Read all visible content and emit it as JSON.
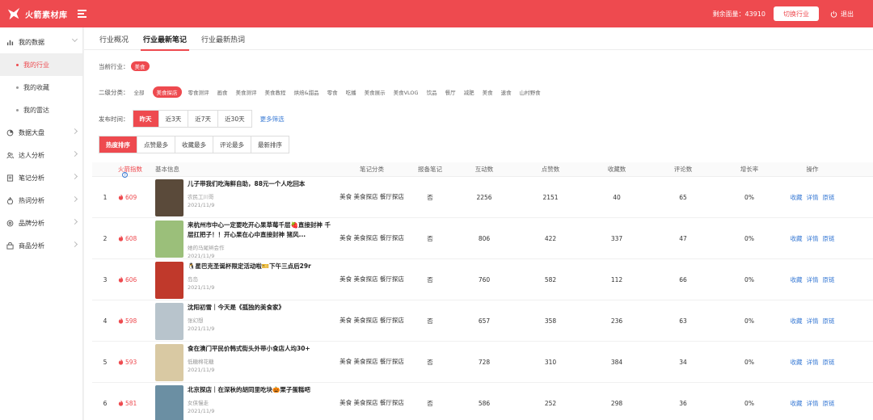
{
  "header": {
    "brand": "火箭素材库",
    "quota_text": "剩余面量：43910",
    "switch_label": "切换行业",
    "logout_label": "退出"
  },
  "sidebar": {
    "groups": [
      {
        "label": "我的数据",
        "icon": "bar-chart-icon",
        "expanded": true,
        "children": [
          "我的行业",
          "我的收藏",
          "我的雷达"
        ],
        "active_child": 0
      },
      {
        "label": "数据大盘",
        "icon": "pie-chart-icon"
      },
      {
        "label": "达人分析",
        "icon": "users-icon"
      },
      {
        "label": "笔记分析",
        "icon": "notes-icon"
      },
      {
        "label": "热词分析",
        "icon": "fire-icon"
      },
      {
        "label": "品牌分析",
        "icon": "brand-icon"
      },
      {
        "label": "商品分析",
        "icon": "goods-icon"
      }
    ]
  },
  "tabs": [
    "行业概况",
    "行业最新笔记",
    "行业最新热词"
  ],
  "active_tab": 1,
  "filters": {
    "industry_label": "当前行业：",
    "industry_value": "美食",
    "sub_label": "二级分类：",
    "sub_categories": [
      "全部",
      "美食探店",
      "零食测评",
      "画食",
      "美食测评",
      "美食教程",
      "烘焙&甜品",
      "零食",
      "吃播",
      "美食展示",
      "美食VLOG",
      "饮品",
      "餐厅",
      "减肥",
      "美食",
      "速食",
      "山村野食"
    ],
    "sub_active": 1,
    "time_label": "发布时间：",
    "time_options": [
      "昨天",
      "近3天",
      "近7天",
      "近30天"
    ],
    "time_active": 0,
    "more_filter": "更多筛选",
    "sort_options": [
      "热度排序",
      "点赞最多",
      "收藏最多",
      "评论最多",
      "最新排序"
    ],
    "sort_active": 0
  },
  "table": {
    "headers": {
      "heat": "火箭指数",
      "info": "基本信息",
      "category": "笔记分类",
      "report": "报备笔记",
      "interact": "互动数",
      "likes": "点赞数",
      "collects": "收藏数",
      "comments": "评论数",
      "growth": "增长率",
      "ops": "操作"
    },
    "ops": [
      "收藏",
      "详情",
      "原链"
    ],
    "rows": [
      {
        "idx": "1",
        "heat": "609",
        "title": "儿子带我们吃海鲜自助，88元一个人吃回本",
        "author": "农民工川哥",
        "date": "2021/11/9",
        "category": "美食 美食探店 餐厅探店",
        "report": "否",
        "interact": "2256",
        "likes": "2151",
        "collects": "40",
        "comments": "65",
        "growth": "0%",
        "thumb": "#5a4a3a"
      },
      {
        "idx": "2",
        "heat": "608",
        "title": "来杭州市中心一定要吃开心果草莓千层🍓直接封神 千层扛把子！！开心果在心中直接封神 猪风...",
        "author": "她的马尾辫会作",
        "date": "2021/11/9",
        "category": "美食 美食探店 餐厅探店",
        "report": "否",
        "interact": "806",
        "likes": "422",
        "collects": "337",
        "comments": "47",
        "growth": "0%",
        "thumb": "#9bbf7a"
      },
      {
        "idx": "3",
        "heat": "606",
        "title": "🐧星巴克圣诞杯限定活动啦🎫下午三点后29r",
        "author": "岛岛",
        "date": "2021/11/9",
        "category": "美食 美食探店 餐厅探店",
        "report": "否",
        "interact": "760",
        "likes": "582",
        "collects": "112",
        "comments": "66",
        "growth": "0%",
        "thumb": "#c0392b"
      },
      {
        "idx": "4",
        "heat": "598",
        "title": "沈阳初雪｜今天是《孤独的美食家》",
        "author": "张幻想",
        "date": "2021/11/9",
        "category": "美食 美食探店 餐厅探店",
        "report": "否",
        "interact": "657",
        "likes": "358",
        "collects": "236",
        "comments": "63",
        "growth": "0%",
        "thumb": "#b8c4cc"
      },
      {
        "idx": "5",
        "heat": "593",
        "title": "食在澳门平民价韩式街头外带小食店人均30+",
        "author": "低糖棉花糖",
        "date": "2021/11/9",
        "category": "美食 美食探店 餐厅探店",
        "report": "否",
        "interact": "728",
        "likes": "310",
        "collects": "384",
        "comments": "34",
        "growth": "0%",
        "thumb": "#d9c9a3"
      },
      {
        "idx": "6",
        "heat": "581",
        "title": "北京探店｜在深秋的胡同里吃块🎃栗子蛋糕吧",
        "author": "女侠慢走",
        "date": "2021/11/9",
        "category": "美食 美食探店 餐厅探店",
        "report": "否",
        "interact": "586",
        "likes": "252",
        "collects": "298",
        "comments": "36",
        "growth": "0%",
        "thumb": "#6b8fa3"
      }
    ]
  }
}
